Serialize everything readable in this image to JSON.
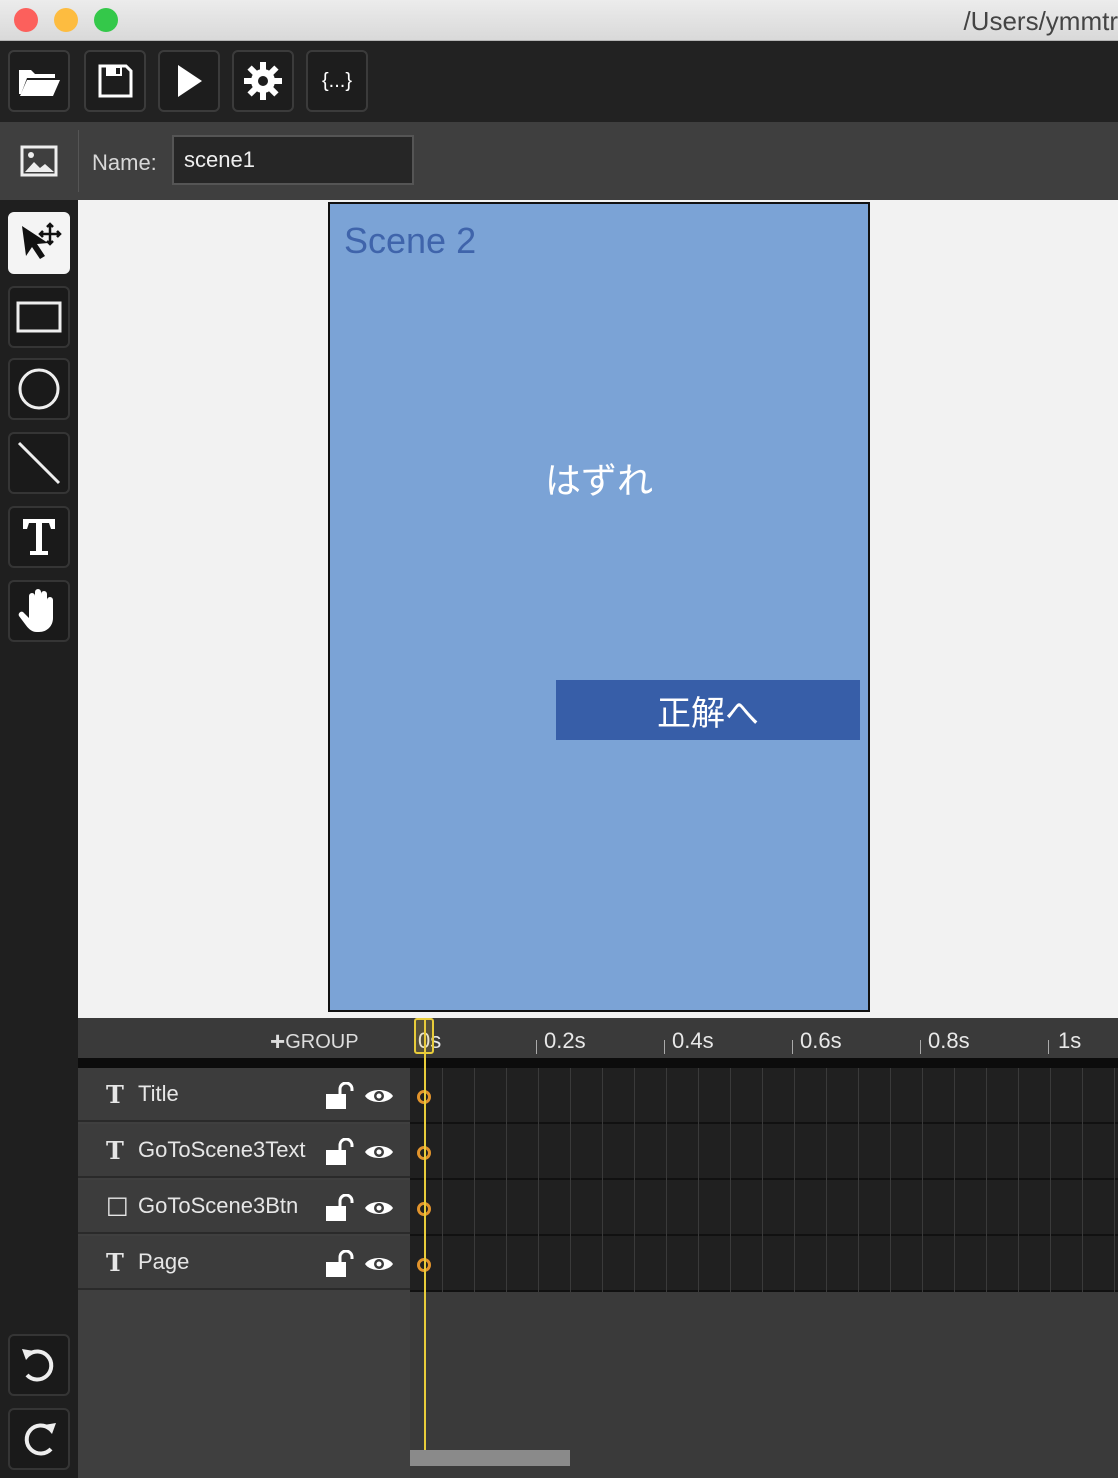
{
  "window": {
    "path": "/Users/ymmtr",
    "colors": {
      "close": "#fc605c",
      "minimize": "#fdbc40",
      "zoom": "#34c84a"
    }
  },
  "toolbar": {
    "buttons": [
      {
        "name": "open-button",
        "icon": "folder-open-icon"
      },
      {
        "name": "save-button",
        "icon": "floppy-disk-icon"
      },
      {
        "name": "play-button",
        "icon": "play-icon"
      },
      {
        "name": "settings-button",
        "icon": "gear-icon"
      },
      {
        "name": "json-button",
        "icon": "braces-icon",
        "label": "{...}"
      }
    ]
  },
  "namebar": {
    "label": "Name:",
    "value": "scene1"
  },
  "tools": [
    "select-move-tool",
    "rectangle-tool",
    "ellipse-tool",
    "line-tool",
    "text-tool",
    "hand-tool"
  ],
  "scene": {
    "title": "Scene 2",
    "message": "はずれ",
    "button_label": "正解へ",
    "colors": {
      "background": "#7ba3d6",
      "title": "#3f64ab",
      "button": "#375ea8"
    }
  },
  "timeline": {
    "group_label": "GROUP",
    "ticks": [
      "0s",
      "0.2s",
      "0.4s",
      "0.6s",
      "0.8s",
      "1s"
    ],
    "layers": [
      {
        "type": "T",
        "name": "Title"
      },
      {
        "type": "T",
        "name": "GoToScene3Text"
      },
      {
        "type": "□",
        "name": "GoToScene3Btn"
      },
      {
        "type": "T",
        "name": "Page"
      }
    ],
    "playhead_color": "#e8cc3a",
    "keyframe_color": "#e2942c"
  }
}
